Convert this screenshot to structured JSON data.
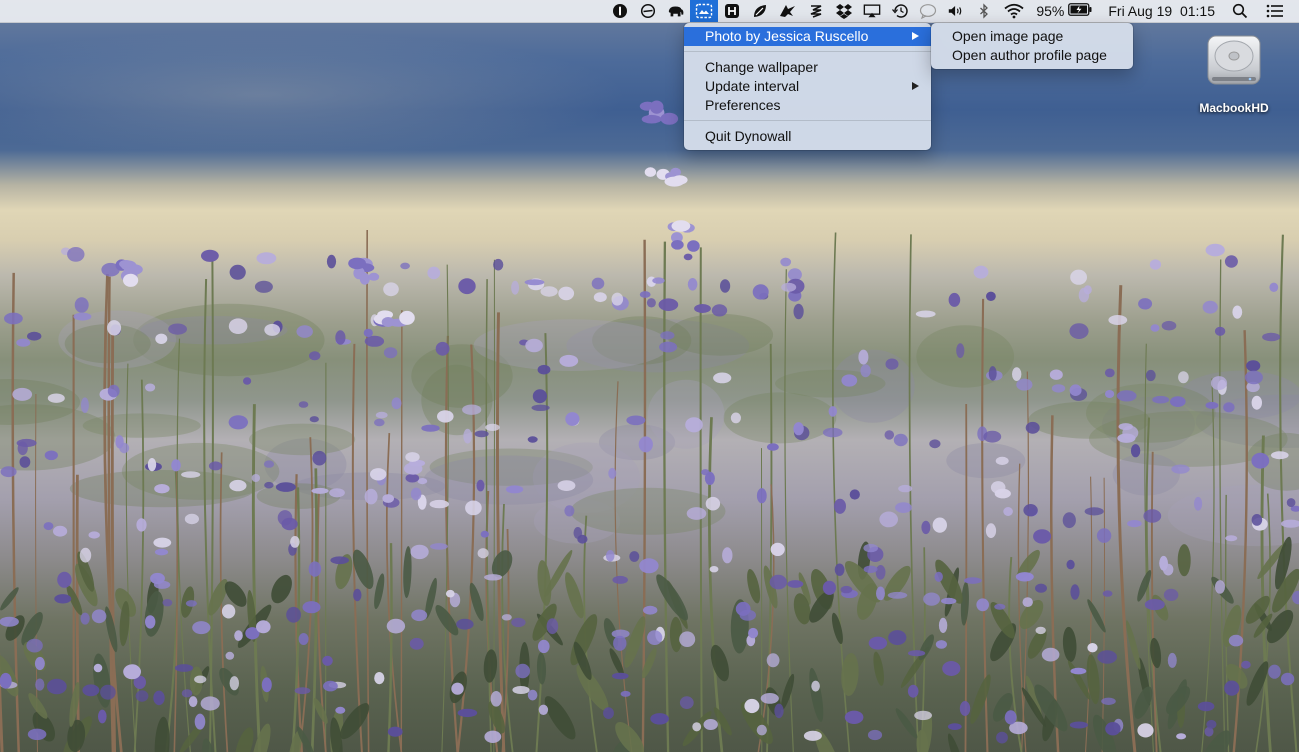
{
  "menubar": {
    "battery_percent": "95%",
    "clock": "Fri Aug 19  01:15",
    "status_icons": [
      "onepassword-icon",
      "circle-slash-icon",
      "elephant-icon",
      "dynowall-icon",
      "h-box-icon",
      "leaf-icon",
      "flight-icon",
      "stripes-icon",
      "dropbox-icon",
      "airplay-icon",
      "time-machine-icon",
      "chat-bubble-icon",
      "volume-icon",
      "bluetooth-icon",
      "wifi-icon",
      "battery-icon",
      "spotlight-search-icon",
      "notification-center-icon"
    ]
  },
  "menu": {
    "photo_item": "Photo by Jessica Ruscello",
    "change_wallpaper": "Change wallpaper",
    "update_interval": "Update interval",
    "preferences": "Preferences",
    "quit": "Quit Dynowall"
  },
  "submenu": {
    "open_image": "Open image page",
    "open_author": "Open author profile page"
  },
  "desktop": {
    "drive_label": "MacbookHD"
  },
  "colors": {
    "menu_highlight": "#2a6fdc",
    "menubar_active": "#1f6fd8"
  }
}
